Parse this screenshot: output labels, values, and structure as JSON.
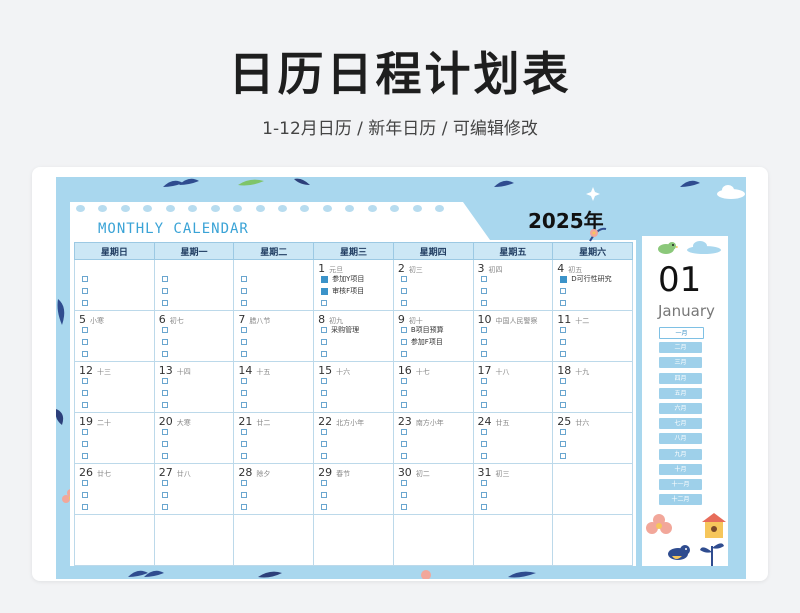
{
  "header": {
    "title": "日历日程计划表",
    "subtitle": "1-12月日历  /  新年日历  /  可编辑修改"
  },
  "calendar": {
    "banner": "MONTHLY CALENDAR",
    "year": "2025年",
    "weekdays": [
      "星期日",
      "星期一",
      "星期二",
      "星期三",
      "星期四",
      "星期五",
      "星期六"
    ],
    "weeks": [
      [
        {
          "day": "",
          "lunar": "",
          "tasks": [
            "",
            "",
            ""
          ]
        },
        {
          "day": "",
          "lunar": "",
          "tasks": [
            "",
            "",
            ""
          ]
        },
        {
          "day": "",
          "lunar": "",
          "tasks": [
            "",
            "",
            ""
          ]
        },
        {
          "day": "1",
          "lunar": "元旦",
          "tasks": [
            "参加Y项目",
            "审核F项目",
            ""
          ],
          "done": [
            true,
            true,
            false
          ]
        },
        {
          "day": "2",
          "lunar": "初三",
          "tasks": [
            "",
            "",
            ""
          ]
        },
        {
          "day": "3",
          "lunar": "初四",
          "tasks": [
            "",
            "",
            ""
          ]
        },
        {
          "day": "4",
          "lunar": "初五",
          "tasks": [
            "D可行性研究",
            "",
            ""
          ],
          "done": [
            true,
            false,
            false
          ]
        }
      ],
      [
        {
          "day": "5",
          "lunar": "小寒",
          "tasks": [
            "",
            "",
            ""
          ]
        },
        {
          "day": "6",
          "lunar": "初七",
          "tasks": [
            "",
            "",
            ""
          ]
        },
        {
          "day": "7",
          "lunar": "腊八节",
          "tasks": [
            "",
            "",
            ""
          ]
        },
        {
          "day": "8",
          "lunar": "初九",
          "tasks": [
            "采购管理",
            "",
            ""
          ]
        },
        {
          "day": "9",
          "lunar": "初十",
          "tasks": [
            "B项目预算",
            "参加F项目",
            ""
          ]
        },
        {
          "day": "10",
          "lunar": "中国人民警察",
          "tasks": [
            "",
            "",
            ""
          ]
        },
        {
          "day": "11",
          "lunar": "十二",
          "tasks": [
            "",
            "",
            ""
          ]
        }
      ],
      [
        {
          "day": "12",
          "lunar": "十三",
          "tasks": [
            "",
            "",
            ""
          ]
        },
        {
          "day": "13",
          "lunar": "十四",
          "tasks": [
            "",
            "",
            ""
          ]
        },
        {
          "day": "14",
          "lunar": "十五",
          "tasks": [
            "",
            "",
            ""
          ]
        },
        {
          "day": "15",
          "lunar": "十六",
          "tasks": [
            "",
            "",
            ""
          ]
        },
        {
          "day": "16",
          "lunar": "十七",
          "tasks": [
            "",
            "",
            ""
          ]
        },
        {
          "day": "17",
          "lunar": "十八",
          "tasks": [
            "",
            "",
            ""
          ]
        },
        {
          "day": "18",
          "lunar": "十九",
          "tasks": [
            "",
            "",
            ""
          ]
        }
      ],
      [
        {
          "day": "19",
          "lunar": "二十",
          "tasks": [
            "",
            "",
            ""
          ]
        },
        {
          "day": "20",
          "lunar": "大寒",
          "tasks": [
            "",
            "",
            ""
          ]
        },
        {
          "day": "21",
          "lunar": "廿二",
          "tasks": [
            "",
            "",
            ""
          ]
        },
        {
          "day": "22",
          "lunar": "北方小年",
          "tasks": [
            "",
            "",
            ""
          ]
        },
        {
          "day": "23",
          "lunar": "南方小年",
          "tasks": [
            "",
            "",
            ""
          ]
        },
        {
          "day": "24",
          "lunar": "廿五",
          "tasks": [
            "",
            "",
            ""
          ]
        },
        {
          "day": "25",
          "lunar": "廿六",
          "tasks": [
            "",
            "",
            ""
          ]
        }
      ],
      [
        {
          "day": "26",
          "lunar": "廿七",
          "tasks": [
            "",
            "",
            ""
          ]
        },
        {
          "day": "27",
          "lunar": "廿八",
          "tasks": [
            "",
            "",
            ""
          ]
        },
        {
          "day": "28",
          "lunar": "除夕",
          "tasks": [
            "",
            "",
            ""
          ]
        },
        {
          "day": "29",
          "lunar": "春节",
          "tasks": [
            "",
            "",
            ""
          ]
        },
        {
          "day": "30",
          "lunar": "初二",
          "tasks": [
            "",
            "",
            ""
          ]
        },
        {
          "day": "31",
          "lunar": "初三",
          "tasks": [
            "",
            "",
            ""
          ]
        },
        {
          "day": "",
          "lunar": "",
          "tasks": [
            "",
            "",
            ""
          ],
          "nochecks": true
        }
      ],
      [
        {
          "day": "",
          "lunar": "",
          "tasks": [],
          "nochecks": true
        },
        {
          "day": "",
          "lunar": "",
          "tasks": [],
          "nochecks": true
        },
        {
          "day": "",
          "lunar": "",
          "tasks": [],
          "nochecks": true
        },
        {
          "day": "",
          "lunar": "",
          "tasks": [],
          "nochecks": true
        },
        {
          "day": "",
          "lunar": "",
          "tasks": [],
          "nochecks": true
        },
        {
          "day": "",
          "lunar": "",
          "tasks": [],
          "nochecks": true
        },
        {
          "day": "",
          "lunar": "",
          "tasks": [],
          "nochecks": true
        }
      ]
    ]
  },
  "sidebar": {
    "month_number": "01",
    "month_name": "January",
    "months": [
      "一月",
      "二月",
      "三月",
      "四月",
      "五月",
      "六月",
      "七月",
      "八月",
      "九月",
      "十月",
      "十一月",
      "十二月"
    ],
    "active_month": 0
  },
  "colors": {
    "background": "#a9d7ee",
    "accent": "#3aa3d6",
    "header_row": "#cce7f5",
    "month_button": "#9ed0ea"
  }
}
